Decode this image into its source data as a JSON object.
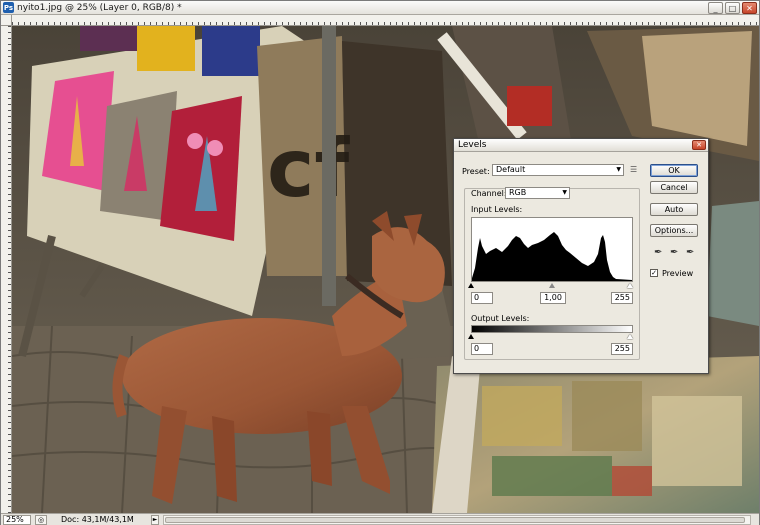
{
  "window": {
    "app_icon": "Ps",
    "title": "nyito1.jpg @ 25% (Layer 0, RGB/8) *",
    "buttons": {
      "minimize": "_",
      "maximize": "□",
      "close": "✕"
    }
  },
  "status_bar": {
    "zoom": "25%",
    "doc_info": "Doc: 43,1M/43,1M",
    "arrow": "►"
  },
  "levels_dialog": {
    "title": "Levels",
    "close_glyph": "✕",
    "preset_label": "Preset:",
    "preset_value": "Default",
    "channel_label": "Channel:",
    "channel_value": "RGB",
    "input_levels_label": "Input Levels:",
    "input_black": "0",
    "input_gamma": "1,00",
    "input_white": "255",
    "output_levels_label": "Output Levels:",
    "output_black": "0",
    "output_white": "255",
    "buttons": {
      "ok": "OK",
      "cancel": "Cancel",
      "auto": "Auto",
      "options": "Options..."
    },
    "preview_label": "Preview",
    "preview_checked": true,
    "check_glyph": "✓"
  },
  "colors": {
    "dialog_bg": "#ece9e0",
    "accent": "#2b4f8a",
    "photo_base": "#585147"
  }
}
